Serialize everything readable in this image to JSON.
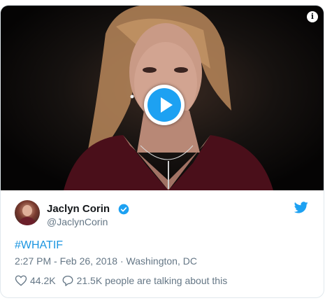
{
  "tweet": {
    "author_name": "Jaclyn Corin",
    "author_handle": "@JaclynCorin",
    "text": "#WHATIF",
    "time": "2:27 PM - Feb 26, 2018",
    "separator": "·",
    "location": "Washington, DC",
    "likes": "44.2K",
    "conversation": "21.5K people are talking about this"
  },
  "media": {
    "type": "video",
    "info_icon": "info-icon",
    "play_icon": "play-icon"
  },
  "colors": {
    "accent": "#1da1f2",
    "link": "#1b95e0",
    "secondary_text": "#657786",
    "primary_text": "#14171a",
    "border": "#e1e8ed"
  },
  "icons": [
    "info-icon",
    "play-icon",
    "verified-badge-icon",
    "twitter-bird-icon",
    "heart-icon",
    "reply-icon"
  ]
}
